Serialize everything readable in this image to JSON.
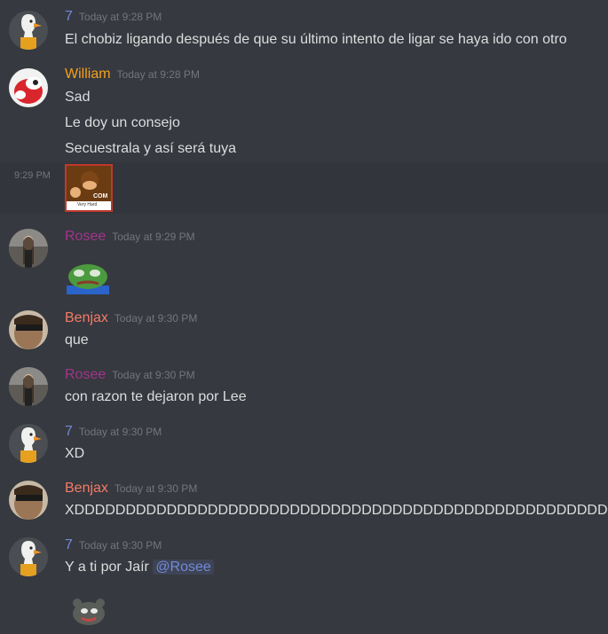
{
  "messages": [
    {
      "author": "7",
      "color": "#7289da",
      "time": "Today at 9:28 PM",
      "lines": [
        "El chobiz ligando después de que su último intento de ligar se haya ido con otro"
      ]
    },
    {
      "author": "William",
      "color": "#f4a11a",
      "time": "Today at 9:28 PM",
      "lines": [
        "Sad",
        "Le doy un consejo",
        "Secuestrala y así será tuya"
      ]
    },
    {
      "side_time": "9:29 PM",
      "image_caption": "Very Hard",
      "image_logo": "COM"
    },
    {
      "author": "Rosee",
      "color": "#a3338c",
      "time": "Today at 9:29 PM"
    },
    {
      "author": "Benjax",
      "color": "#f47b67",
      "time": "Today at 9:30 PM",
      "lines": [
        "que"
      ]
    },
    {
      "author": "Rosee",
      "color": "#a3338c",
      "time": "Today at 9:30 PM",
      "lines": [
        "con razon te dejaron por Lee"
      ]
    },
    {
      "author": "7",
      "color": "#7289da",
      "time": "Today at 9:30 PM",
      "lines": [
        "XD"
      ]
    },
    {
      "author": "Benjax",
      "color": "#f47b67",
      "time": "Today at 9:30 PM",
      "lines": [
        "XDDDDDDDDDDDDDDDDDDDDDDDDDDDDDDDDDDDDDDDDDDDDDDDDDDDDD"
      ]
    },
    {
      "author": "7",
      "color": "#7289da",
      "time": "Today at 9:30 PM",
      "text": "Y a ti por Jaír",
      "mention": "@Rosee"
    }
  ]
}
